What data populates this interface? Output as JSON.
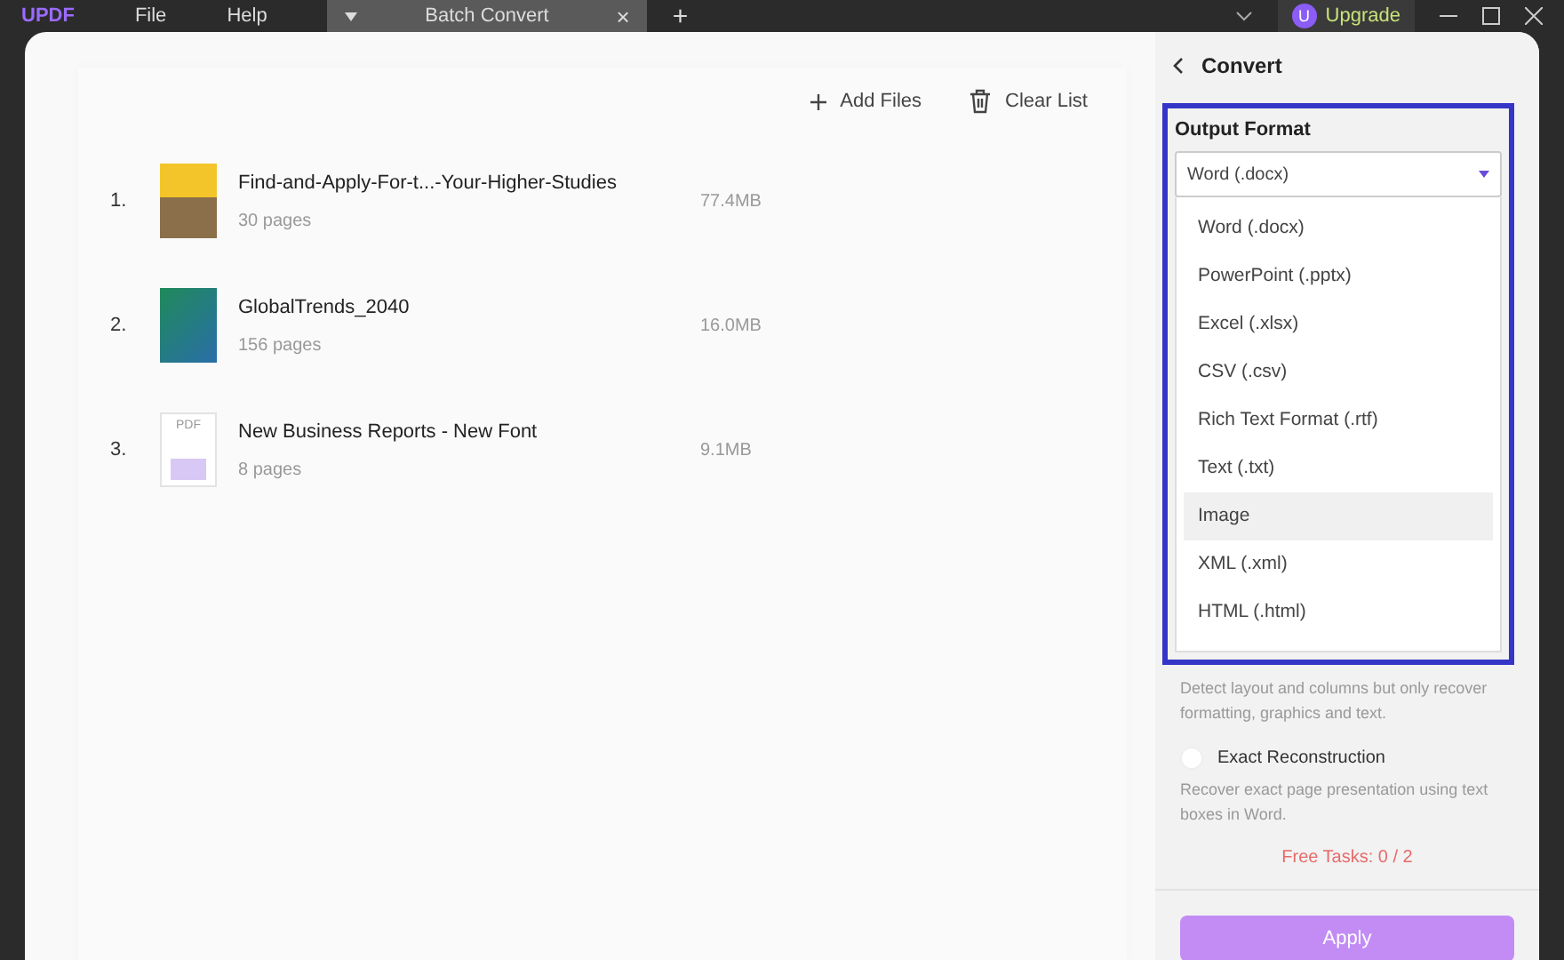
{
  "titlebar": {
    "logo": "UPDF",
    "menus": [
      "File",
      "Help"
    ],
    "tab": {
      "label": "Batch Convert",
      "close": "×"
    },
    "new_tab": "+",
    "upgrade": {
      "avatar": "U",
      "label": "Upgrade"
    }
  },
  "toolbar": {
    "add_files": "Add Files",
    "clear_list": "Clear List"
  },
  "files": [
    {
      "index": "1.",
      "name": "Find-and-Apply-For-t...-Your-Higher-Studies",
      "pages": "30 pages",
      "size": "77.4MB",
      "kind": "photo"
    },
    {
      "index": "2.",
      "name": "GlobalTrends_2040",
      "pages": "156 pages",
      "size": "16.0MB",
      "kind": "cover"
    },
    {
      "index": "3.",
      "name": "New Business Reports - New Font",
      "pages": "8 pages",
      "size": "9.1MB",
      "kind": "pdf",
      "badge": "PDF"
    }
  ],
  "panel": {
    "title": "Convert",
    "output_format": {
      "label": "Output Format",
      "value": "Word (.docx)",
      "expanded": true,
      "options": [
        {
          "label": "Word (.docx)",
          "highlighted": false
        },
        {
          "label": "PowerPoint (.pptx)",
          "highlighted": false
        },
        {
          "label": "Excel (.xlsx)",
          "highlighted": false
        },
        {
          "label": "CSV (.csv)",
          "highlighted": false
        },
        {
          "label": "Rich Text Format (.rtf)",
          "highlighted": false
        },
        {
          "label": "Text (.txt)",
          "highlighted": false
        },
        {
          "label": "Image",
          "highlighted": true
        },
        {
          "label": "XML (.xml)",
          "highlighted": false
        },
        {
          "label": "HTML (.html)",
          "highlighted": false
        }
      ]
    },
    "layout_hint": "Detect layout and columns but only recover formatting, graphics and text.",
    "exact": {
      "label": "Exact Reconstruction",
      "checked": false,
      "hint": "Recover exact page presentation using text boxes in Word."
    },
    "free_tasks": "Free Tasks: 0 / 2",
    "apply": "Apply"
  }
}
